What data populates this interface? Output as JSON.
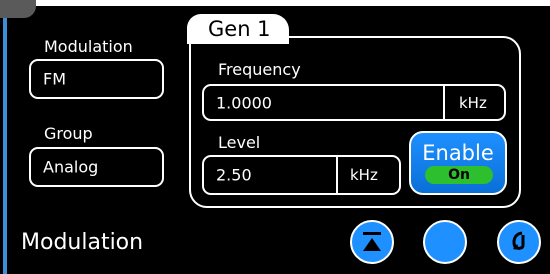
{
  "modulation": {
    "label": "Modulation",
    "value": "FM"
  },
  "group": {
    "label": "Group",
    "value": "Analog"
  },
  "generator": {
    "tab_title": "Gen 1",
    "frequency": {
      "label": "Frequency",
      "value": "1.0000",
      "unit": "kHz"
    },
    "level": {
      "label": "Level",
      "value": "2.50",
      "unit": "kHz"
    },
    "enable": {
      "label": "Enable",
      "state": "On"
    }
  },
  "footer": {
    "page_title": "Modulation"
  },
  "colors": {
    "accent": "#1e90ff",
    "on": "#2dbf2d",
    "frame": "#3a8fd6"
  },
  "icons": [
    "collapse-icon",
    "blank-action-icon",
    "return-icon"
  ]
}
